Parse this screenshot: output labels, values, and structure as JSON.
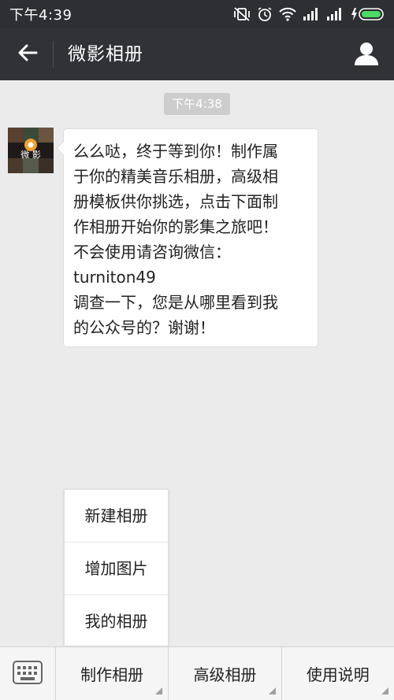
{
  "status_bar": {
    "time": "下午4:39"
  },
  "header": {
    "title": "微影相册"
  },
  "chat": {
    "timestamp": "下午4:38",
    "avatar_text": "微 影",
    "message_lines": [
      "么么哒，终于等到你！制作属",
      "于你的精美音乐相册，高级相",
      "册模板供你挑选，点击下面制",
      "作相册开始你的影集之旅吧！",
      "不会使用请咨询微信：",
      "turniton49",
      "调查一下，您是从哪里看到我",
      "的公众号的？谢谢！"
    ]
  },
  "popup_menu": {
    "items": [
      "新建相册",
      "增加图片",
      "我的相册"
    ]
  },
  "bottom_menu": {
    "items": [
      "制作相册",
      "高级相册",
      "使用说明"
    ]
  },
  "colors": {
    "status_bar": "#2e2f33",
    "title_bar": "#303236",
    "chat_bg": "#ebebeb",
    "battery": "#4cd964"
  }
}
